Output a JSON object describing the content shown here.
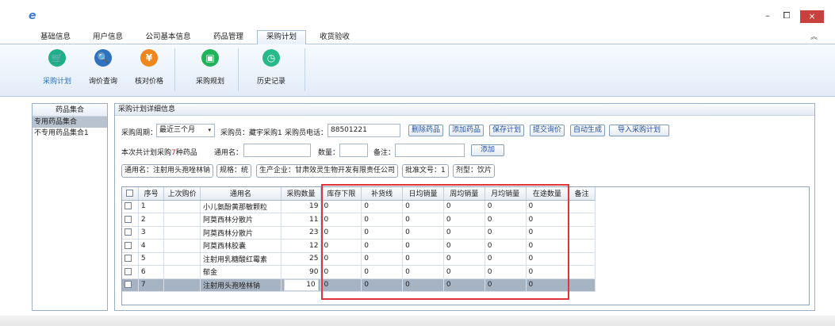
{
  "window": {
    "minimize": "–",
    "maximize": "⧠",
    "close": "×"
  },
  "menu": {
    "tabs": [
      "基础信息",
      "用户信息",
      "公司基本信息",
      "药品管理",
      "采购计划",
      "收货验收"
    ],
    "active_index": 4,
    "collapse_glyph": "︽"
  },
  "ribbon": {
    "items": [
      {
        "label": "采购计划",
        "icon": "cart-icon",
        "color": "#1fb08a",
        "glyph": "🛒",
        "active": true
      },
      {
        "label": "询价查询",
        "icon": "search-doc-icon",
        "color": "#2f72c1",
        "glyph": "🔍",
        "active": false
      },
      {
        "label": "核对价格",
        "icon": "price-check-icon",
        "color": "#f0861e",
        "glyph": "¥",
        "active": false
      },
      {
        "label": "采购规划",
        "icon": "planning-icon",
        "color": "#1fb35a",
        "glyph": "▣",
        "active": false
      },
      {
        "label": "历史记录",
        "icon": "clock-icon",
        "color": "#28b98b",
        "glyph": "◷",
        "active": false
      }
    ]
  },
  "left_panel": {
    "title": "药品集合",
    "items": [
      "专用药品集合",
      "不专用药品集合1"
    ],
    "selected_index": 0
  },
  "main": {
    "title": "采购计划详细信息",
    "period_label": "采购周期：",
    "period_value": "最近三个月",
    "buyer_text": "采购员：藏宇采购1",
    "phone_label": "采购员电话：",
    "phone_value": "88501221",
    "buttons": {
      "delete": "删除药品",
      "add": "添加药品",
      "save": "保存计划",
      "inquiry": "提交询价",
      "auto": "自动生成",
      "import": "导入采购计划",
      "add_small": "添加"
    },
    "summary_prefix": "本次共计划采购",
    "summary_count": "7",
    "summary_suffix": "种药品",
    "generic_label": "通用名：",
    "generic_value": "",
    "qty_label": "数量：",
    "qty_value": "",
    "note_label": "备注：",
    "note_value": "",
    "tags": [
      "通用名：注射用头孢唑林钠",
      "规格：统",
      "生产企业：甘肃效灵生物开发有限责任公司",
      "批准文号：1",
      "剂型：饮片"
    ]
  },
  "grid": {
    "columns": [
      "序号",
      "上次购价",
      "通用名",
      "采购数量",
      "库存下限",
      "补货线",
      "日均销量",
      "周均销量",
      "月均销量",
      "在途数量",
      "备注"
    ],
    "rows": [
      [
        "1",
        "",
        "小儿氨酚黄那敏颗粒",
        "19",
        "0",
        "0",
        "0",
        "0",
        "0",
        "0",
        ""
      ],
      [
        "2",
        "",
        "阿莫西林分散片",
        "11",
        "0",
        "0",
        "0",
        "0",
        "0",
        "0",
        ""
      ],
      [
        "3",
        "",
        "阿莫西林分散片",
        "23",
        "0",
        "0",
        "0",
        "0",
        "0",
        "0",
        ""
      ],
      [
        "4",
        "",
        "阿莫西林胶囊",
        "12",
        "0",
        "0",
        "0",
        "0",
        "0",
        "0",
        ""
      ],
      [
        "5",
        "",
        "注射用乳糖酸红霉素",
        "25",
        "0",
        "0",
        "0",
        "0",
        "0",
        "0",
        ""
      ],
      [
        "6",
        "",
        "郁金",
        "90",
        "0",
        "0",
        "0",
        "0",
        "0",
        "0",
        ""
      ],
      [
        "7",
        "",
        "注射用头孢唑林钠",
        "10",
        "0",
        "0",
        "0",
        "0",
        "0",
        "0",
        ""
      ]
    ],
    "selected_row": 6,
    "highlight_color": "#e0343a"
  }
}
